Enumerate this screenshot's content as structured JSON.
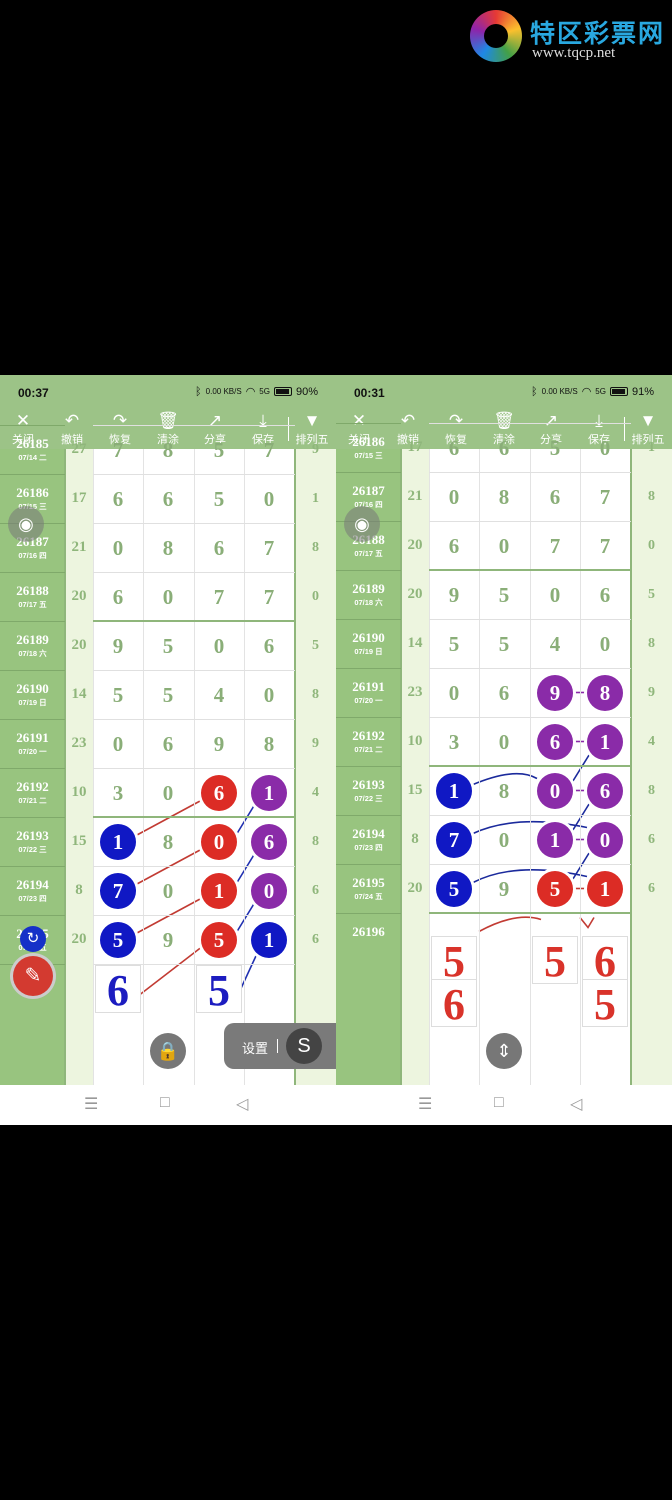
{
  "logo": {
    "title": "特区彩票网",
    "url": "www.tqcp.net"
  },
  "toolbar": {
    "close": "关闭",
    "undo": "撤销",
    "redo": "恢复",
    "clear": "清涂",
    "share": "分享",
    "save": "保存",
    "mode": "排列五"
  },
  "icons": {
    "close": "close-icon",
    "undo": "undo-icon",
    "redo": "redo-icon",
    "clear": "trash-icon",
    "share": "share-icon",
    "save": "download-icon",
    "mode": "triangle-down-icon",
    "eye": "eye-icon",
    "lock": "lock-icon",
    "expand": "expand-vertical-icon",
    "pen": "pen-icon",
    "sync": "sync-icon"
  },
  "colors": {
    "header_green": "#9cc387",
    "ball_red": "#dc2c25",
    "ball_blue": "#1018c4",
    "ball_purple": "#8a2ba8"
  },
  "left": {
    "status": {
      "time": "00:37",
      "net": "0.00 KB/S",
      "signal": "5G",
      "battery": "90%"
    },
    "rows": [
      {
        "no": "26185",
        "date": "07/14 二",
        "sum": "27",
        "d": [
          "7",
          "8",
          "5",
          "7"
        ],
        "r": "9"
      },
      {
        "no": "26186",
        "date": "07/15 三",
        "sum": "17",
        "d": [
          "6",
          "6",
          "5",
          "0"
        ],
        "r": "1"
      },
      {
        "no": "26187",
        "date": "07/16 四",
        "sum": "21",
        "d": [
          "0",
          "8",
          "6",
          "7"
        ],
        "r": "8"
      },
      {
        "no": "26188",
        "date": "07/17 五",
        "sum": "20",
        "d": [
          "6",
          "0",
          "7",
          "7"
        ],
        "r": "0"
      },
      {
        "no": "26189",
        "date": "07/18 六",
        "sum": "20",
        "d": [
          "9",
          "5",
          "0",
          "6"
        ],
        "r": "5"
      },
      {
        "no": "26190",
        "date": "07/19 日",
        "sum": "14",
        "d": [
          "5",
          "5",
          "4",
          "0"
        ],
        "r": "8"
      },
      {
        "no": "26191",
        "date": "07/20 一",
        "sum": "23",
        "d": [
          "0",
          "6",
          "9",
          "8"
        ],
        "r": "9"
      },
      {
        "no": "26192",
        "date": "07/21 二",
        "sum": "10",
        "d": [
          "3",
          "0",
          "6",
          "1"
        ],
        "r": "4"
      },
      {
        "no": "26193",
        "date": "07/22 三",
        "sum": "15",
        "d": [
          "1",
          "8",
          "0",
          "6"
        ],
        "r": "8"
      },
      {
        "no": "26194",
        "date": "07/23 四",
        "sum": "8",
        "d": [
          "7",
          "0",
          "1",
          "0"
        ],
        "r": "6"
      },
      {
        "no": "26195",
        "date": "07/24 五",
        "sum": "20",
        "d": [
          "5",
          "9",
          "5",
          "1"
        ],
        "r": "6"
      },
      {
        "no": "26196",
        "date": "",
        "sum": "",
        "d": [
          "",
          "",
          "",
          ""
        ],
        "r": ""
      }
    ],
    "predict": [
      "6",
      "5"
    ],
    "settings": "设置",
    "settings_btn": "S"
  },
  "right": {
    "status": {
      "time": "00:31",
      "net": "0.00 KB/S",
      "signal": "5G",
      "battery": "91%"
    },
    "rows": [
      {
        "no": "26186",
        "date": "07/15 三",
        "sum": "17",
        "d": [
          "6",
          "6",
          "5",
          "0"
        ],
        "r": "1"
      },
      {
        "no": "26187",
        "date": "07/16 四",
        "sum": "21",
        "d": [
          "0",
          "8",
          "6",
          "7"
        ],
        "r": "8"
      },
      {
        "no": "26188",
        "date": "07/17 五",
        "sum": "20",
        "d": [
          "6",
          "0",
          "7",
          "7"
        ],
        "r": "0"
      },
      {
        "no": "26189",
        "date": "07/18 六",
        "sum": "20",
        "d": [
          "9",
          "5",
          "0",
          "6"
        ],
        "r": "5"
      },
      {
        "no": "26190",
        "date": "07/19 日",
        "sum": "14",
        "d": [
          "5",
          "5",
          "4",
          "0"
        ],
        "r": "8"
      },
      {
        "no": "26191",
        "date": "07/20 一",
        "sum": "23",
        "d": [
          "0",
          "6",
          "9",
          "8"
        ],
        "r": "9"
      },
      {
        "no": "26192",
        "date": "07/21 二",
        "sum": "10",
        "d": [
          "3",
          "0",
          "6",
          "1"
        ],
        "r": "4"
      },
      {
        "no": "26193",
        "date": "07/22 三",
        "sum": "15",
        "d": [
          "1",
          "8",
          "0",
          "6"
        ],
        "r": "8"
      },
      {
        "no": "26194",
        "date": "07/23 四",
        "sum": "8",
        "d": [
          "7",
          "0",
          "1",
          "0"
        ],
        "r": "6"
      },
      {
        "no": "26195",
        "date": "07/24 五",
        "sum": "20",
        "d": [
          "5",
          "9",
          "5",
          "1"
        ],
        "r": "6"
      },
      {
        "no": "26196",
        "date": "",
        "sum": "",
        "d": [
          "",
          "",
          "",
          ""
        ],
        "r": ""
      }
    ],
    "predict1": [
      "5",
      "5",
      "6"
    ],
    "predict2": [
      "6",
      "5"
    ]
  },
  "nav": {
    "menu": "☰",
    "home": "□",
    "back": "◁"
  }
}
